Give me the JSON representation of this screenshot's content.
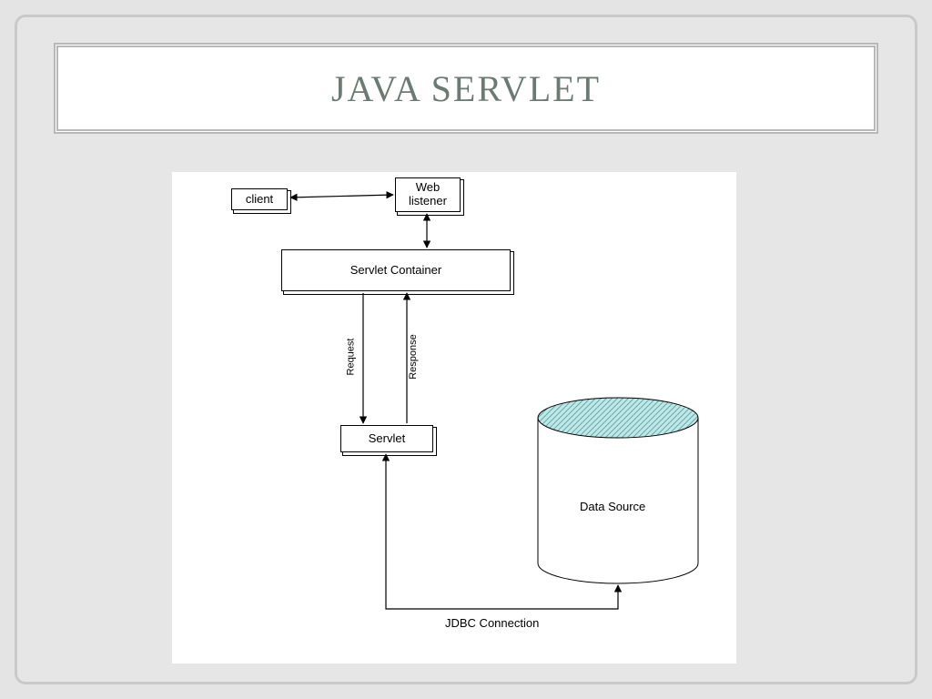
{
  "slide": {
    "title": "JAVA SERVLET"
  },
  "diagram": {
    "nodes": {
      "client": "client",
      "web_listener": "Web\nlistener",
      "servlet_container": "Servlet Container",
      "servlet": "Servlet",
      "data_source": "Data Source"
    },
    "edges": {
      "request": "Request",
      "response": "Response",
      "jdbc": "JDBC Connection"
    }
  }
}
